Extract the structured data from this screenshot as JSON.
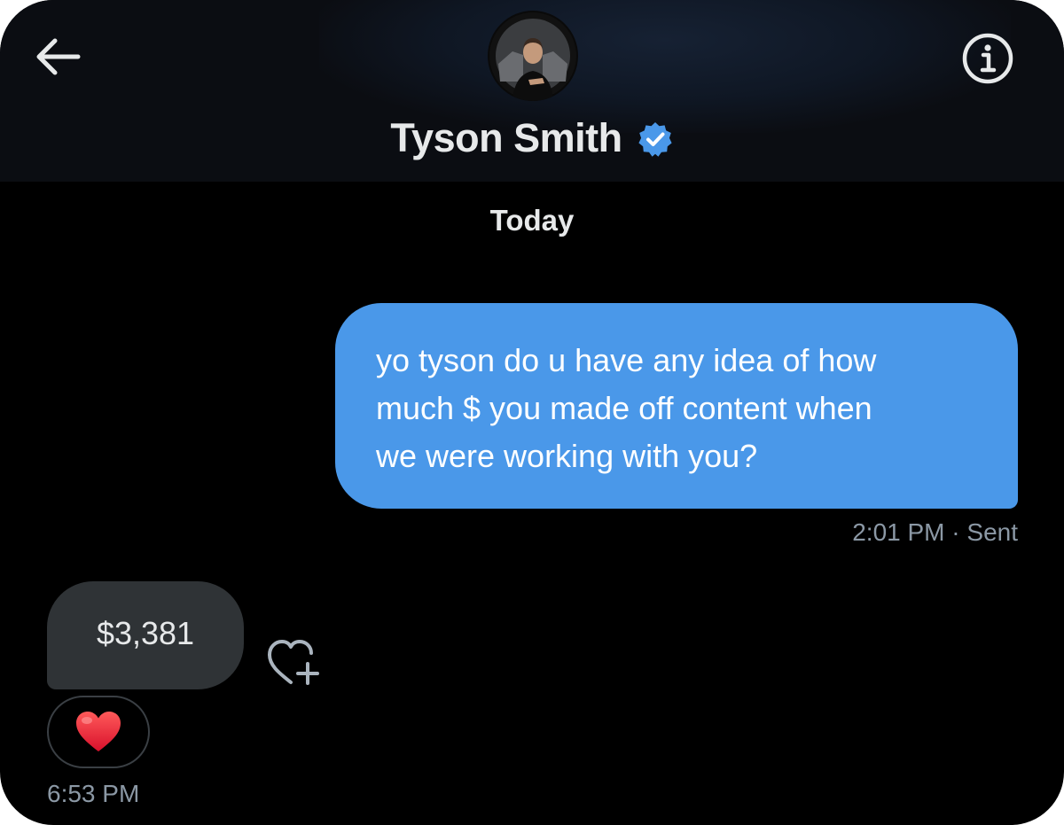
{
  "header": {
    "back_icon": "arrow-left-icon",
    "info_icon": "info-circle-icon",
    "contact_name": "Tyson Smith",
    "verified_icon": "verified-badge-icon",
    "verified_color": "#4a98e9"
  },
  "conversation": {
    "date_separator": "Today",
    "messages": [
      {
        "direction": "outgoing",
        "lines": [
          "yo tyson do u have any idea of how",
          "much $ you made off content when",
          "we were working with you?"
        ],
        "time": "2:01 PM",
        "status": "· Sent",
        "bubble_color": "#4a98e9"
      },
      {
        "direction": "incoming",
        "text": "$3,381",
        "reaction": "❤️",
        "react_icon": "heart-plus-icon",
        "time": "6:53 PM",
        "bubble_color": "#2f3336"
      }
    ]
  }
}
